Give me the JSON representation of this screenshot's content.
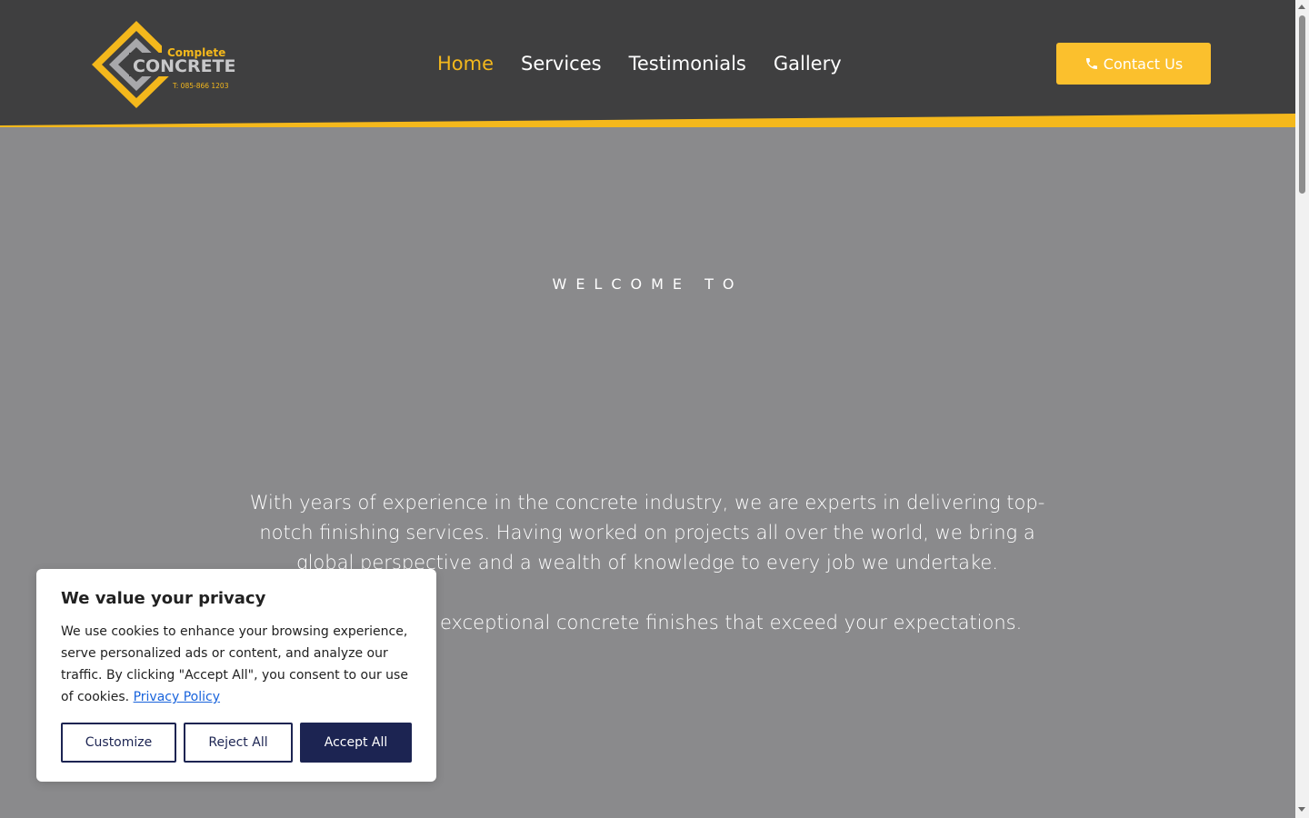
{
  "header": {
    "logo": {
      "line1": "Complete",
      "line2": "CONCRETE",
      "phone": "T: 085-866 1203"
    },
    "nav": [
      {
        "label": "Home",
        "active": true
      },
      {
        "label": "Services",
        "active": false
      },
      {
        "label": "Testimonials",
        "active": false
      },
      {
        "label": "Gallery",
        "active": false
      }
    ],
    "contact_label": "Contact Us",
    "colors": {
      "accent": "#f4b81c",
      "background": "#3f3f40"
    }
  },
  "hero": {
    "eyebrow": "WELCOME TO",
    "paragraph1": "With years of experience in the concrete industry, we are experts in delivering top-notch finishing services. Having worked on projects all over the world, we bring a global perspective and a wealth of knowledge to every job we undertake.",
    "paragraph2_visible": "exceptional concrete finishes that exceed your expectations."
  },
  "cookie": {
    "title": "We value your privacy",
    "body": "We use cookies to enhance your browsing experience, serve personalized ads or content, and analyze our traffic. By clicking \"Accept All\", you consent to our use of cookies.",
    "policy_link": "Privacy Policy",
    "customize": "Customize",
    "reject": "Reject All",
    "accept": "Accept All"
  }
}
